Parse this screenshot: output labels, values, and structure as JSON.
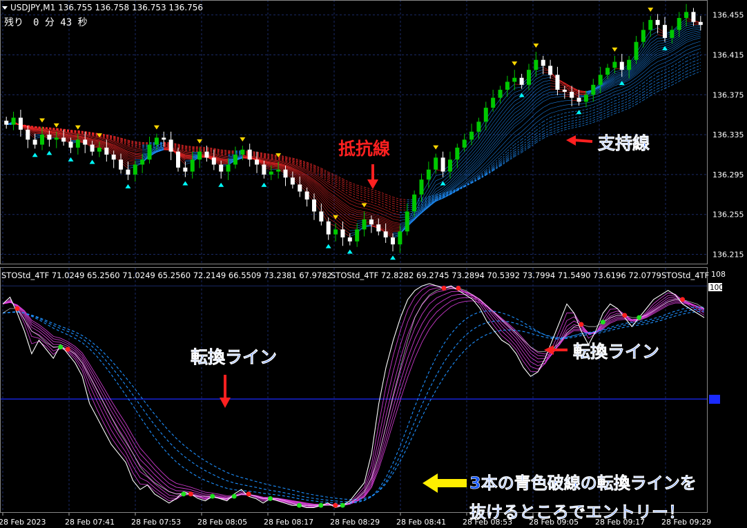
{
  "header": {
    "symbol_line": "USDJPY,M1  136.755 136.758 136.753 136.756",
    "timer": "残り　0 分 43 秒"
  },
  "indicator": {
    "label_a": "STOStd_4TF 71.0249 65.2560 71.0249 65.2560 72.2149 66.5509 73.2381 67.9782",
    "label_b": "STOStd_4TF 72.8282 69.2745 73.2894 70.5392 73.7994 71.5490 73.6196 72.0779",
    "label_c": "STOStd_4TF",
    "scale_top": "108",
    "scale_100": "100"
  },
  "annotations": {
    "resistance": "抵抗線",
    "support": "支持線",
    "turn_line_left": "転換ライン",
    "turn_line_right": "転換ライン",
    "entry_line1": "3本の青色破線の転換ラインを",
    "entry_line2": "抜けるところでエントリー！"
  },
  "colors": {
    "background": "#000000",
    "grid": "#1a2a66",
    "bull": "#00c800",
    "bear": "#ffffff",
    "resistance_band": "#ff2a2a",
    "support_band": "#1e90ff",
    "stoch_band": "#e040e0",
    "annotation_red": "#ff2020",
    "annotation_blue": "#1a5cff",
    "annotation_yellow": "#ffee00",
    "arrow_up": "#00ffff",
    "arrow_down": "#ffd700",
    "dot_red": "#ff2020",
    "dot_green": "#20e020"
  },
  "chart_data": [
    {
      "type": "candlestick",
      "symbol": "USDJPY",
      "timeframe": "M1",
      "yticks": [
        136.455,
        136.415,
        136.375,
        136.335,
        136.295,
        136.255,
        136.215
      ],
      "ylim": [
        136.205,
        136.47
      ],
      "closes": [
        136.345,
        136.352,
        136.34,
        136.33,
        136.325,
        136.335,
        136.33,
        136.332,
        136.328,
        136.322,
        136.33,
        136.325,
        136.318,
        136.322,
        136.315,
        136.31,
        136.3,
        136.295,
        136.305,
        136.31,
        136.325,
        136.332,
        136.33,
        136.318,
        136.302,
        136.298,
        136.31,
        136.318,
        136.312,
        136.305,
        136.298,
        136.305,
        136.315,
        136.32,
        136.31,
        136.305,
        136.295,
        136.298,
        136.3,
        136.292,
        136.285,
        136.278,
        136.27,
        136.258,
        136.248,
        136.235,
        136.24,
        136.232,
        136.228,
        136.24,
        136.25,
        136.245,
        136.238,
        136.232,
        136.225,
        136.238,
        136.258,
        136.275,
        136.29,
        136.3,
        136.312,
        136.298,
        136.31,
        136.322,
        136.33,
        136.338,
        136.348,
        136.362,
        136.372,
        136.38,
        136.388,
        136.392,
        136.385,
        136.4,
        136.41,
        136.404,
        136.395,
        136.38,
        136.378,
        136.372,
        136.368,
        136.375,
        136.385,
        136.395,
        136.402,
        136.408,
        136.4,
        136.41,
        136.428,
        136.44,
        136.45,
        136.445,
        136.432,
        136.44,
        136.452,
        136.458,
        136.448,
        136.445
      ],
      "xticks": [
        "28 Feb 2023",
        "28 Feb 07:41",
        "28 Feb 07:53",
        "28 Feb 08:05",
        "28 Feb 08:17",
        "28 Feb 08:29",
        "28 Feb 08:41",
        "28 Feb 08:53",
        "28 Feb 09:05",
        "28 Feb 09:17",
        "28 Feb 09:29"
      ]
    },
    {
      "type": "line",
      "name": "STOStd_4TF",
      "ylim": [
        0,
        108
      ],
      "levels": [
        100,
        50
      ],
      "k": [
        92,
        95,
        88,
        80,
        70,
        76,
        72,
        68,
        74,
        70,
        66,
        60,
        48,
        42,
        36,
        30,
        26,
        22,
        14,
        10,
        12,
        8,
        6,
        4,
        6,
        9,
        8,
        6,
        5,
        7,
        6,
        5,
        8,
        10,
        7,
        6,
        4,
        6,
        5,
        4,
        3,
        3,
        2,
        2,
        3,
        4,
        2,
        3,
        5,
        9,
        13,
        26,
        48,
        64,
        76,
        86,
        94,
        98,
        100,
        101,
        100,
        99,
        100,
        98,
        96,
        94,
        90,
        84,
        80,
        76,
        74,
        70,
        64,
        60,
        62,
        68,
        76,
        84,
        92,
        88,
        80,
        74,
        80,
        88,
        92,
        90,
        86,
        82,
        86,
        90,
        94,
        96,
        98,
        96,
        92,
        90,
        88,
        86
      ],
      "d": [
        88,
        90,
        90,
        85,
        80,
        78,
        75,
        73,
        73,
        72,
        70,
        66,
        60,
        54,
        48,
        42,
        36,
        31,
        26,
        20,
        16,
        13,
        11,
        9,
        8,
        8,
        8,
        7,
        7,
        7,
        6,
        6,
        7,
        8,
        8,
        7,
        6,
        6,
        6,
        5,
        4,
        3,
        3,
        3,
        3,
        3,
        3,
        3,
        4,
        6,
        9,
        15,
        25,
        38,
        52,
        64,
        76,
        86,
        92,
        96,
        98,
        99,
        99,
        99,
        98,
        96,
        94,
        91,
        88,
        85,
        82,
        79,
        76,
        73,
        71,
        71,
        72,
        75,
        79,
        82,
        83,
        82,
        82,
        84,
        86,
        87,
        87,
        86,
        86,
        87,
        89,
        91,
        93,
        94,
        94,
        93,
        92,
        90
      ]
    }
  ]
}
